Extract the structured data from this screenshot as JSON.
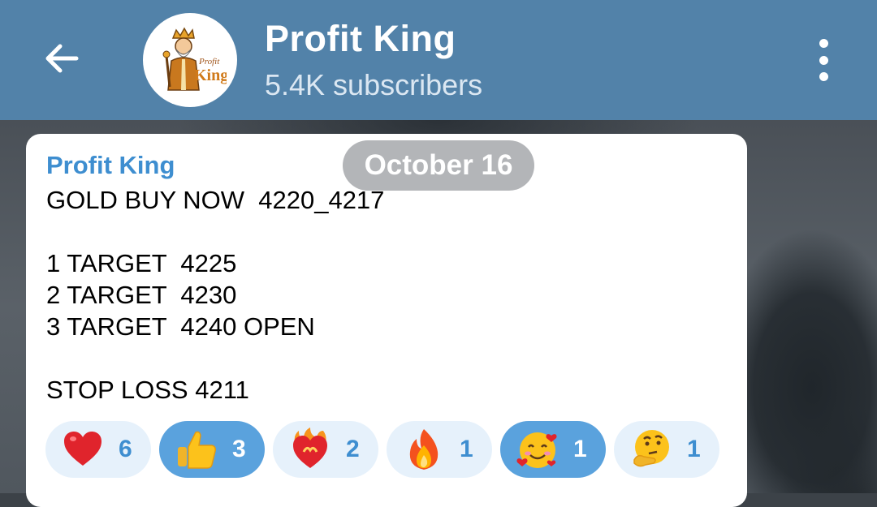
{
  "header": {
    "title": "Profit King",
    "subtitle": "5.4K subscribers",
    "avatar_logo_text": "Profit King"
  },
  "date_pill": "October 16",
  "message": {
    "sender": "Profit King",
    "lines": [
      "GOLD BUY NOW  4220_4217",
      "",
      "1 TARGET  4225",
      "2 TARGET  4230",
      "3 TARGET  4240 OPEN",
      "",
      "STOP LOSS 4211"
    ]
  },
  "reactions": [
    {
      "emoji": "heart-emoji",
      "count": "6",
      "active": false
    },
    {
      "emoji": "thumbs-up-emoji",
      "count": "3",
      "active": true
    },
    {
      "emoji": "heart-on-fire-emoji",
      "count": "2",
      "active": false
    },
    {
      "emoji": "fire-emoji",
      "count": "1",
      "active": false
    },
    {
      "emoji": "smiling-face-with-hearts-emoji",
      "count": "1",
      "active": true
    },
    {
      "emoji": "thinking-face-emoji",
      "count": "1",
      "active": false
    }
  ],
  "colors": {
    "header_bg": "#5282a9",
    "accent": "#3e8ed0",
    "reaction_bg": "#e6f1fb",
    "reaction_active_bg": "#5aa2dd"
  }
}
